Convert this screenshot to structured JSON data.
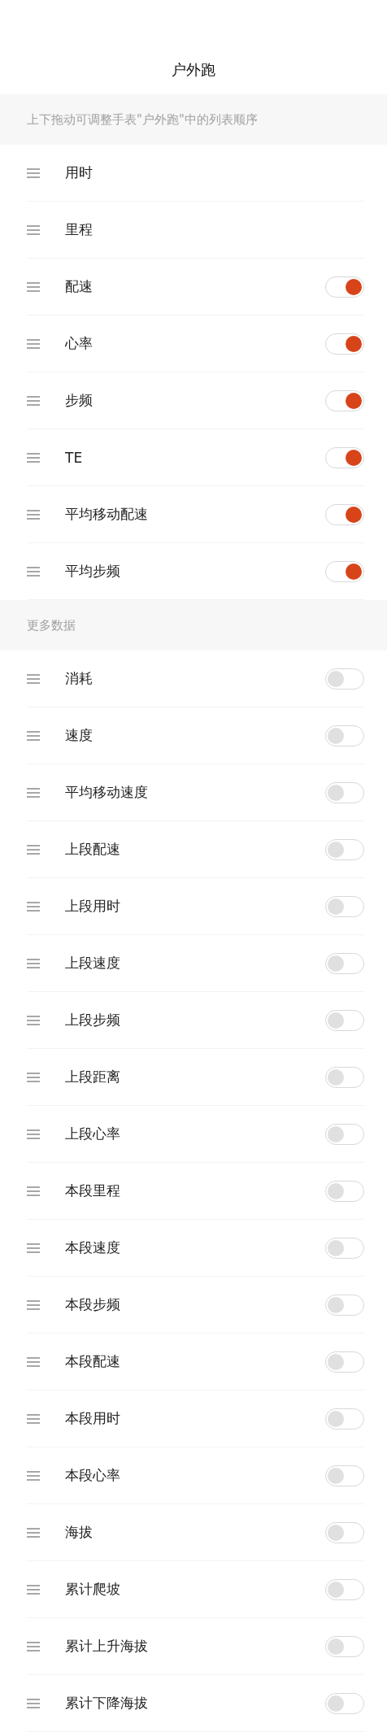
{
  "title": "户外跑",
  "sections": [
    {
      "header": "上下拖动可调整手表\"户外跑\"中的列表顺序",
      "items": [
        {
          "label": "用时",
          "kind": "fixed"
        },
        {
          "label": "里程",
          "kind": "fixed"
        },
        {
          "label": "配速",
          "kind": "toggle",
          "on": true
        },
        {
          "label": "心率",
          "kind": "toggle",
          "on": true
        },
        {
          "label": "步频",
          "kind": "toggle",
          "on": true
        },
        {
          "label": "TE",
          "kind": "toggle",
          "on": true
        },
        {
          "label": "平均移动配速",
          "kind": "toggle",
          "on": true
        },
        {
          "label": "平均步频",
          "kind": "toggle",
          "on": true
        }
      ]
    },
    {
      "header": "更多数据",
      "items": [
        {
          "label": "消耗",
          "kind": "toggle",
          "on": false
        },
        {
          "label": "速度",
          "kind": "toggle",
          "on": false
        },
        {
          "label": "平均移动速度",
          "kind": "toggle",
          "on": false
        },
        {
          "label": "上段配速",
          "kind": "toggle",
          "on": false
        },
        {
          "label": "上段用时",
          "kind": "toggle",
          "on": false
        },
        {
          "label": "上段速度",
          "kind": "toggle",
          "on": false
        },
        {
          "label": "上段步频",
          "kind": "toggle",
          "on": false
        },
        {
          "label": "上段距离",
          "kind": "toggle",
          "on": false
        },
        {
          "label": "上段心率",
          "kind": "toggle",
          "on": false
        },
        {
          "label": "本段里程",
          "kind": "toggle",
          "on": false
        },
        {
          "label": "本段速度",
          "kind": "toggle",
          "on": false
        },
        {
          "label": "本段步频",
          "kind": "toggle",
          "on": false
        },
        {
          "label": "本段配速",
          "kind": "toggle",
          "on": false
        },
        {
          "label": "本段用时",
          "kind": "toggle",
          "on": false
        },
        {
          "label": "本段心率",
          "kind": "toggle",
          "on": false
        },
        {
          "label": "海拔",
          "kind": "toggle",
          "on": false
        },
        {
          "label": "累计爬坡",
          "kind": "toggle",
          "on": false
        },
        {
          "label": "累计上升海拔",
          "kind": "toggle",
          "on": false
        },
        {
          "label": "累计下降海拔",
          "kind": "toggle",
          "on": false
        }
      ]
    }
  ]
}
